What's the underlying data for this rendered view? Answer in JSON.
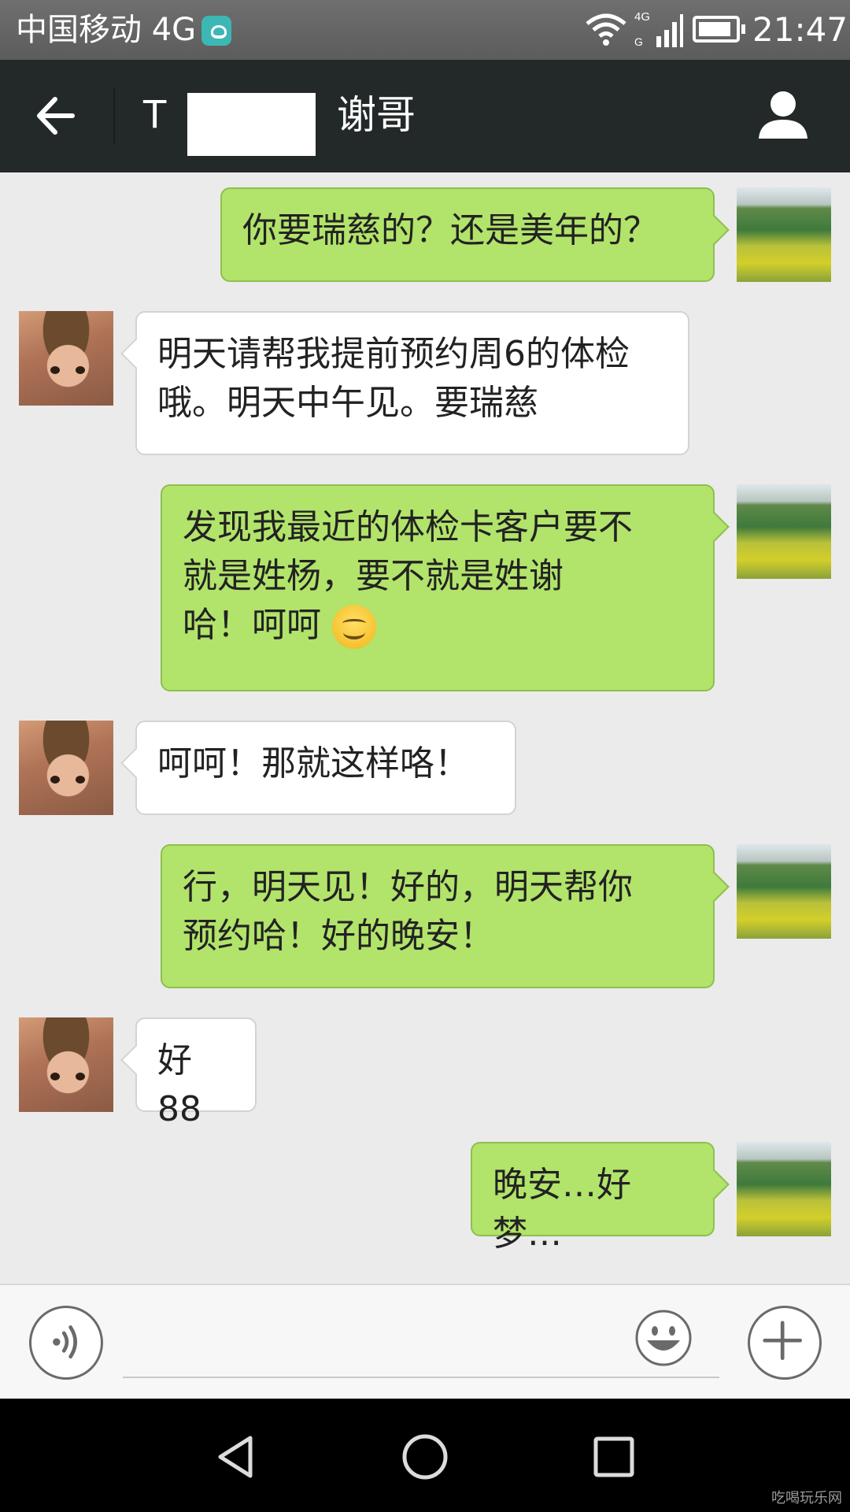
{
  "status_bar": {
    "carrier": "中国移动 4G",
    "network_badge": "4G",
    "time": "21:47"
  },
  "header": {
    "title_prefix": "T",
    "title": "谢哥"
  },
  "messages": [
    {
      "direction": "out",
      "text": "你要瑞慈的？还是美年的？"
    },
    {
      "direction": "in",
      "text": "明天请帮我提前预约周6的体检\n哦。明天中午见。要瑞慈"
    },
    {
      "direction": "out",
      "text": "发现我最近的体检卡客户要不\n就是姓杨，要不就是姓谢\n哈！呵呵",
      "emoji": "smiley"
    },
    {
      "direction": "in",
      "text": "呵呵！那就这样咯！"
    },
    {
      "direction": "out",
      "text": "行，明天见！好的，明天帮你\n预约哈！好的晚安！"
    },
    {
      "direction": "in",
      "text": "好88"
    },
    {
      "direction": "out",
      "text": "晚安…好梦…"
    }
  ],
  "input_bar": {
    "placeholder": ""
  },
  "watermark": "吃喝玩乐网",
  "colors": {
    "outgoing_bubble": "#b2e36b",
    "incoming_bubble": "#ffffff",
    "header_bg": "#232829",
    "chat_bg": "#ebebeb"
  },
  "icons": [
    "huawei-icon",
    "wifi-icon",
    "signal-icon",
    "battery-icon",
    "back-arrow-icon",
    "profile-icon",
    "voice-icon",
    "emoji-icon",
    "plus-icon",
    "nav-back-icon",
    "nav-home-icon",
    "nav-recents-icon"
  ]
}
